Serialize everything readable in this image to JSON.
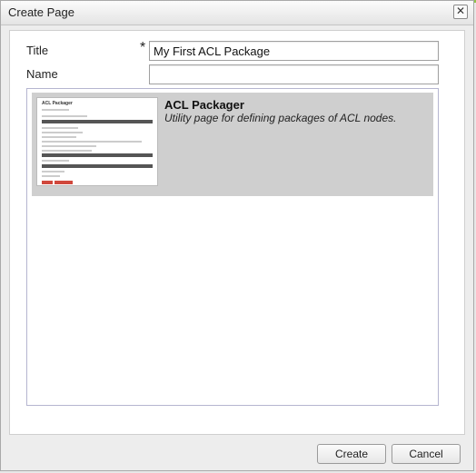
{
  "window": {
    "title": "Create Page"
  },
  "form": {
    "title_label": "Title",
    "required_marker": "*",
    "title_value": "My First ACL Package",
    "name_label": "Name",
    "name_value": ""
  },
  "templates": [
    {
      "name": "ACL Packager",
      "description": "Utility page for defining packages of ACL nodes.",
      "thumbnail_title": "ACL Packager",
      "selected": true
    }
  ],
  "buttons": {
    "create": "Create",
    "cancel": "Cancel"
  },
  "colors": {
    "accent_strip": "#8fc24a",
    "selected_bg": "#cfcfcf",
    "thumb_button": "#d0483c"
  }
}
